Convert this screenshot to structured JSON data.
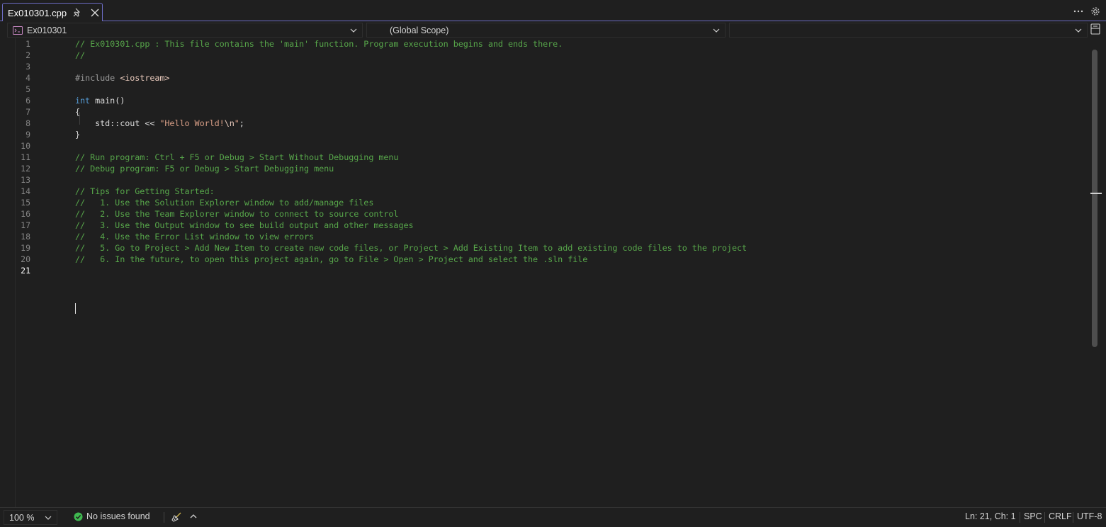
{
  "tab": {
    "title": "Ex010301.cpp"
  },
  "navbar": {
    "project": "Ex010301",
    "scope": "(Global Scope)",
    "member": ""
  },
  "editor": {
    "line_numbers": [
      "1",
      "2",
      "3",
      "4",
      "5",
      "6",
      "7",
      "8",
      "9",
      "10",
      "11",
      "12",
      "13",
      "14",
      "15",
      "16",
      "17",
      "18",
      "19",
      "20",
      "21"
    ],
    "current_line": 21,
    "lines": [
      [
        {
          "t": "cm",
          "v": "// Ex010301.cpp : This file contains the 'main' function. Program execution begins and ends there."
        }
      ],
      [
        {
          "t": "cm",
          "v": "//"
        }
      ],
      [],
      [
        {
          "t": "pp",
          "v": "#include "
        },
        {
          "t": "inc",
          "v": "<iostream>"
        }
      ],
      [],
      [
        {
          "t": "kw",
          "v": "int"
        },
        {
          "t": "plain",
          "v": " main()"
        }
      ],
      [
        {
          "t": "plain",
          "v": "{"
        }
      ],
      [
        {
          "t": "plain",
          "v": "    std::cout << "
        },
        {
          "t": "str",
          "v": "\"Hello World!"
        },
        {
          "t": "esc",
          "v": "\\n"
        },
        {
          "t": "str",
          "v": "\""
        },
        {
          "t": "plain",
          "v": ";"
        }
      ],
      [
        {
          "t": "plain",
          "v": "}"
        }
      ],
      [],
      [
        {
          "t": "cm",
          "v": "// Run program: Ctrl + F5 or Debug > Start Without Debugging menu"
        }
      ],
      [
        {
          "t": "cm",
          "v": "// Debug program: F5 or Debug > Start Debugging menu"
        }
      ],
      [],
      [
        {
          "t": "cm",
          "v": "// Tips for Getting Started:"
        }
      ],
      [
        {
          "t": "cm",
          "v": "//   1. Use the Solution Explorer window to add/manage files"
        }
      ],
      [
        {
          "t": "cm",
          "v": "//   2. Use the Team Explorer window to connect to source control"
        }
      ],
      [
        {
          "t": "cm",
          "v": "//   3. Use the Output window to see build output and other messages"
        }
      ],
      [
        {
          "t": "cm",
          "v": "//   4. Use the Error List window to view errors"
        }
      ],
      [
        {
          "t": "cm",
          "v": "//   5. Go to Project > Add New Item to create new code files, or Project > Add Existing Item to add existing code files to the project"
        }
      ],
      [
        {
          "t": "cm",
          "v": "//   6. In the future, to open this project again, go to File > Open > Project and select the .sln file"
        }
      ],
      []
    ]
  },
  "statusbar": {
    "zoom": "100 %",
    "issues": "No issues found",
    "position": "Ln: 21, Ch: 1",
    "whitespace": "SPC",
    "line_endings": "CRLF",
    "encoding": "UTF-8"
  },
  "colors": {
    "background": "#1f1f1f",
    "comment": "#57a64a",
    "keyword": "#569cd6",
    "string": "#d69d85",
    "tab_border": "#6c6cc4",
    "ok_check": "#3fb950"
  }
}
